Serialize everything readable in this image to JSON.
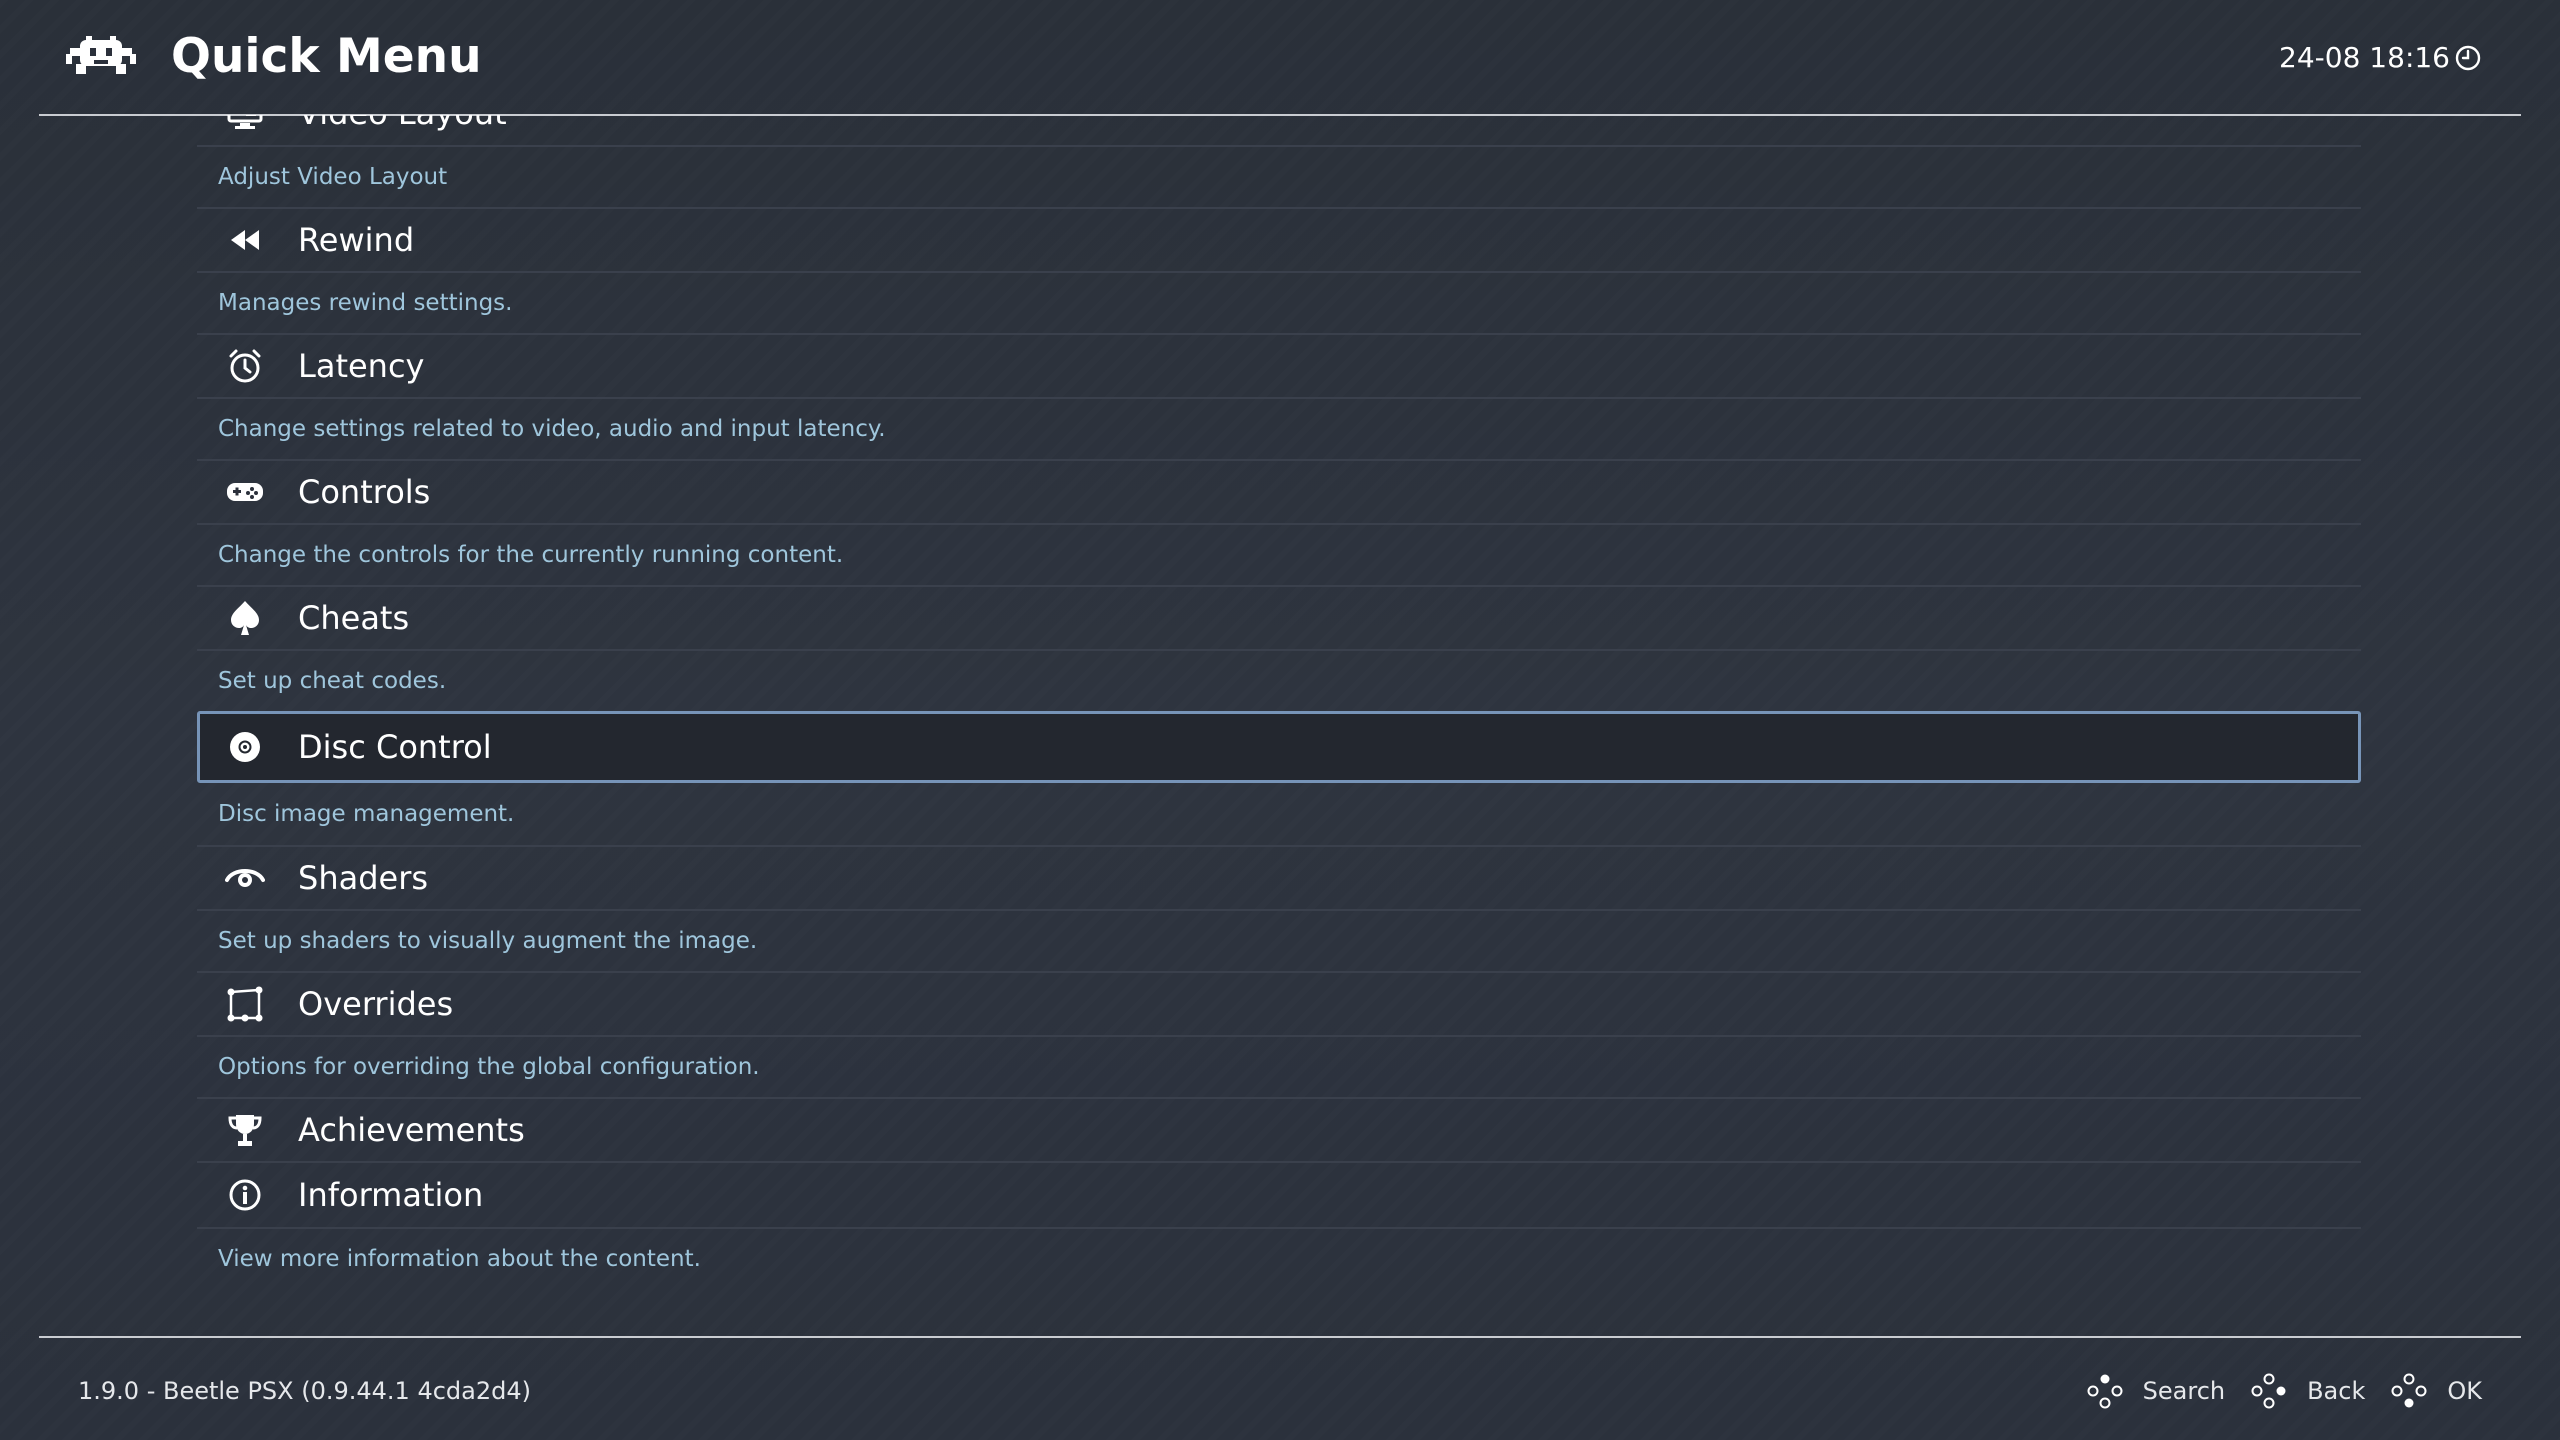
{
  "header": {
    "title": "Quick Menu",
    "clock": "24-08 18:16"
  },
  "menu": {
    "items": [
      {
        "label": "Video Layout",
        "desc": "Adjust Video Layout",
        "icon": "monitor-icon"
      },
      {
        "label": "Rewind",
        "desc": "Manages rewind settings.",
        "icon": "rewind-icon"
      },
      {
        "label": "Latency",
        "desc": "Change settings related to video, audio and input latency.",
        "icon": "stopwatch-icon"
      },
      {
        "label": "Controls",
        "desc": "Change the controls for the currently running content.",
        "icon": "gamepad-icon"
      },
      {
        "label": "Cheats",
        "desc": "Set up cheat codes.",
        "icon": "spade-icon"
      },
      {
        "label": "Disc Control",
        "desc": "Disc image management.",
        "icon": "disc-icon",
        "selected": true
      },
      {
        "label": "Shaders",
        "desc": "Set up shaders to visually augment the image.",
        "icon": "eye-icon"
      },
      {
        "label": "Overrides",
        "desc": "Options for overriding the global configuration.",
        "icon": "overrides-icon"
      },
      {
        "label": "Achievements",
        "desc": "",
        "icon": "trophy-icon"
      },
      {
        "label": "Information",
        "desc": "View more information about the content.",
        "icon": "info-icon"
      }
    ]
  },
  "footer": {
    "version": "1.9.0 - Beetle PSX (0.9.44.1 4cda2d4)",
    "hints": {
      "search": "Search",
      "back": "Back",
      "ok": "OK"
    }
  },
  "colors": {
    "accent_border": "#7794b8",
    "description_text": "#9fc6dc",
    "selected_bg": "#23272f"
  }
}
